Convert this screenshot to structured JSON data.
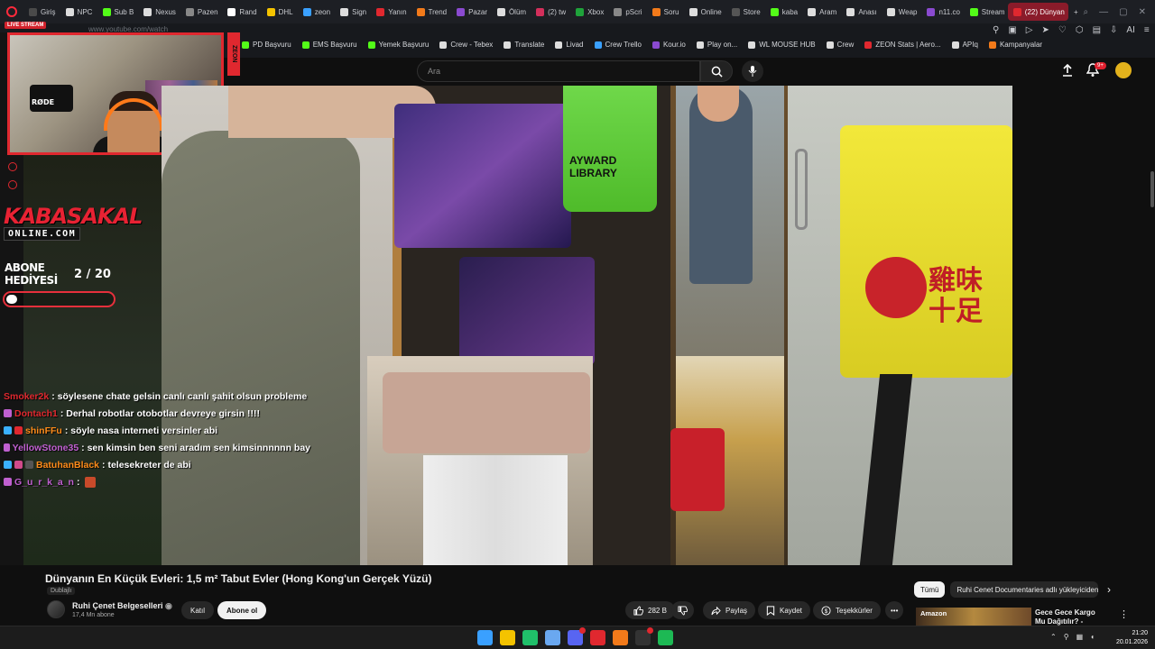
{
  "browser": {
    "tabs": [
      {
        "label": "Giriş",
        "color": "#4a4a4a"
      },
      {
        "label": "NPC",
        "color": "#ddd"
      },
      {
        "label": "Sub B",
        "color": "#53fc18"
      },
      {
        "label": "Nexus",
        "color": "#ddd"
      },
      {
        "label": "Pazen",
        "color": "#888"
      },
      {
        "label": "Rand",
        "color": "#fff"
      },
      {
        "label": "DHL",
        "color": "#f4c300"
      },
      {
        "label": "zeon",
        "color": "#3aa0ff"
      },
      {
        "label": "Sign",
        "color": "#ddd"
      },
      {
        "label": "Yanın",
        "color": "#e0282f"
      },
      {
        "label": "Trend",
        "color": "#f27a1a"
      },
      {
        "label": "Pazar",
        "color": "#8a4ad0"
      },
      {
        "label": "Ölüm",
        "color": "#ddd"
      },
      {
        "label": "(2) tw",
        "color": "#d32f5b"
      },
      {
        "label": "Xbox",
        "color": "#1fa33b"
      },
      {
        "label": "pScri",
        "color": "#888"
      },
      {
        "label": "Soru",
        "color": "#f27a1a"
      },
      {
        "label": "Online",
        "color": "#ddd"
      },
      {
        "label": "Store",
        "color": "#555"
      },
      {
        "label": "kaba",
        "color": "#53fc18"
      },
      {
        "label": "Aram",
        "color": "#ddd"
      },
      {
        "label": "Anası",
        "color": "#ddd"
      },
      {
        "label": "Weap",
        "color": "#ddd"
      },
      {
        "label": "n11.co",
        "color": "#8a4ad0"
      },
      {
        "label": "Stream",
        "color": "#53fc18"
      }
    ],
    "active_tab": "(22) Dünyan",
    "url": "www.youtube.com/watch",
    "bookmarks": [
      {
        "label": "PD Başvuru",
        "color": "#53fc18"
      },
      {
        "label": "EMS Başvuru",
        "color": "#53fc18"
      },
      {
        "label": "Yemek Başvuru",
        "color": "#53fc18"
      },
      {
        "label": "Crew - Tebex",
        "color": "#ddd"
      },
      {
        "label": "Translate",
        "color": "#ddd"
      },
      {
        "label": "Livad",
        "color": "#ddd"
      },
      {
        "label": "Crew Trello",
        "color": "#3aa0ff"
      },
      {
        "label": "Kour.io",
        "color": "#8a4ad0"
      },
      {
        "label": "Play on...",
        "color": "#ddd"
      },
      {
        "label": "WL MOUSE HUB",
        "color": "#ddd"
      },
      {
        "label": "Crew",
        "color": "#ddd"
      },
      {
        "label": "ZEON Stats | Aero...",
        "color": "#e0282f"
      },
      {
        "label": "APIq",
        "color": "#ddd"
      },
      {
        "label": "Kampanyalar",
        "color": "#f27a1a"
      }
    ],
    "nav_ai": "AI"
  },
  "youtube": {
    "search_placeholder": "Ara",
    "notif_count": "9+"
  },
  "overlay": {
    "live_tag": "LIVE STREAM",
    "side_badge": "ZEON",
    "webcam_label": "RØDE",
    "brand": "KABASAKAL",
    "brand_sub": "ONLINE.COM",
    "sub_goal_label_1": "ABONE",
    "sub_goal_label_2": "HEDİYESİ",
    "sub_goal_count": "2 / 20",
    "sub_goal_progress": 0.1,
    "chat": [
      {
        "user": "Smoker2k",
        "user_color": "#e0282f",
        "message": ": söylesene chate gelsin canlı canlı şahit olsun probleme",
        "badges": []
      },
      {
        "user": "Dontach1",
        "user_color": "#e0282f",
        "message": ": Derhal robotlar otobotlar devreye girsin !!!!",
        "badges": [
          "#c060d0"
        ]
      },
      {
        "user": "shinFFu",
        "user_color": "#ff8c1a",
        "message": ": söyle nasa interneti versinler abi",
        "badges": [
          "#3ab0ff",
          "#e0282f"
        ]
      },
      {
        "user": "YellowStone35",
        "user_color": "#c060d0",
        "message": ": sen kimsin ben seni aradım sen kimsinnnnnn bay",
        "badges": [
          "#c060d0"
        ]
      },
      {
        "user": "BatuhanBlack",
        "user_color": "#ff8c1a",
        "message": ": telesekreter de abi",
        "badges": [
          "#3ab0ff",
          "#d04a8a",
          "#555"
        ]
      },
      {
        "user": "G_u_r_k_a_n",
        "user_color": "#c060d0",
        "message": ":",
        "badges": [
          "#c060d0"
        ]
      }
    ]
  },
  "video": {
    "title": "Dünyanın En Küçük Evleri: 1,5 m² Tabut Evler (Hong Kong'un Gerçek Yüzü)",
    "dubbed_label": "Dublajlı",
    "green_bag_text": "AYWARD\nLIBRARY",
    "red_text": "雞味\n十足",
    "channel_name": "Ruhi Çenet Belgeselleri",
    "channel_subs": "17,4 Mn abone",
    "join_label": "Katıl",
    "subscribe_label": "Abone ol",
    "likes": "282 B",
    "share_label": "Paylaş",
    "save_label": "Kaydet",
    "thanks_label": "Teşekkürler",
    "more_label": "•••"
  },
  "sidebar": {
    "chip_all": "Tümü",
    "chip_channel": "Ruhi Cenet Documentaries adlı yükleyiciden",
    "rec_thumb_label": "Amazon",
    "rec_title": "Gece Gece Kargo Mu Dağıtılır? - Amerika'da"
  },
  "taskbar": {
    "apps": [
      {
        "name": "windows-start",
        "color": "#3aa0ff"
      },
      {
        "name": "file-explorer",
        "color": "#f4c300"
      },
      {
        "name": "app-green",
        "color": "#20c06a"
      },
      {
        "name": "app-blue",
        "color": "#6aa8f0"
      },
      {
        "name": "discord",
        "color": "#5865f2"
      },
      {
        "name": "opera",
        "color": "#e0282f"
      },
      {
        "name": "app-orange",
        "color": "#f27a1a"
      },
      {
        "name": "obs",
        "color": "#333"
      },
      {
        "name": "spotify",
        "color": "#1db954"
      }
    ],
    "time": "21:20",
    "date": "20.01.2026"
  }
}
